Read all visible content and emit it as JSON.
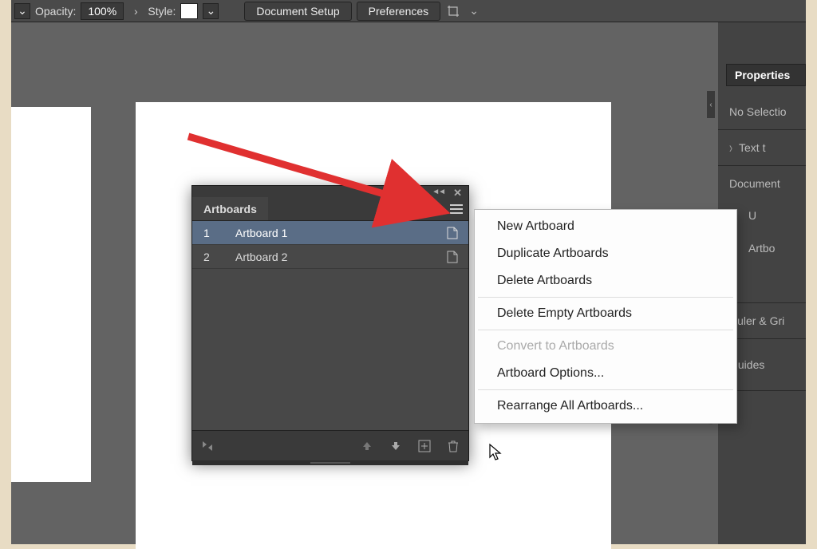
{
  "control_bar": {
    "opacity_label": "Opacity:",
    "opacity_value": "100%",
    "style_label": "Style:",
    "doc_setup": "Document Setup",
    "prefs": "Preferences"
  },
  "right_panel": {
    "header": "Properties",
    "no_selection": "No Selectio",
    "text": "Text t",
    "document": "Document",
    "units_row": "U",
    "artboard_row": "Artbo",
    "ruler": "Ruler & Gri",
    "guides": "Guides"
  },
  "panel": {
    "title": "Artboards",
    "rows": [
      {
        "num": "1",
        "name": "Artboard 1"
      },
      {
        "num": "2",
        "name": "Artboard 2"
      }
    ]
  },
  "context_menu": {
    "items": [
      {
        "label": "New Artboard",
        "disabled": false
      },
      {
        "label": "Duplicate Artboards",
        "disabled": false
      },
      {
        "label": "Delete Artboards",
        "disabled": false
      },
      {
        "sep": true
      },
      {
        "label": "Delete Empty Artboards",
        "disabled": false
      },
      {
        "sep": true
      },
      {
        "label": "Convert to Artboards",
        "disabled": true
      },
      {
        "label": "Artboard Options...",
        "disabled": false
      },
      {
        "sep": true
      },
      {
        "label": "Rearrange All Artboards...",
        "disabled": false
      }
    ]
  }
}
